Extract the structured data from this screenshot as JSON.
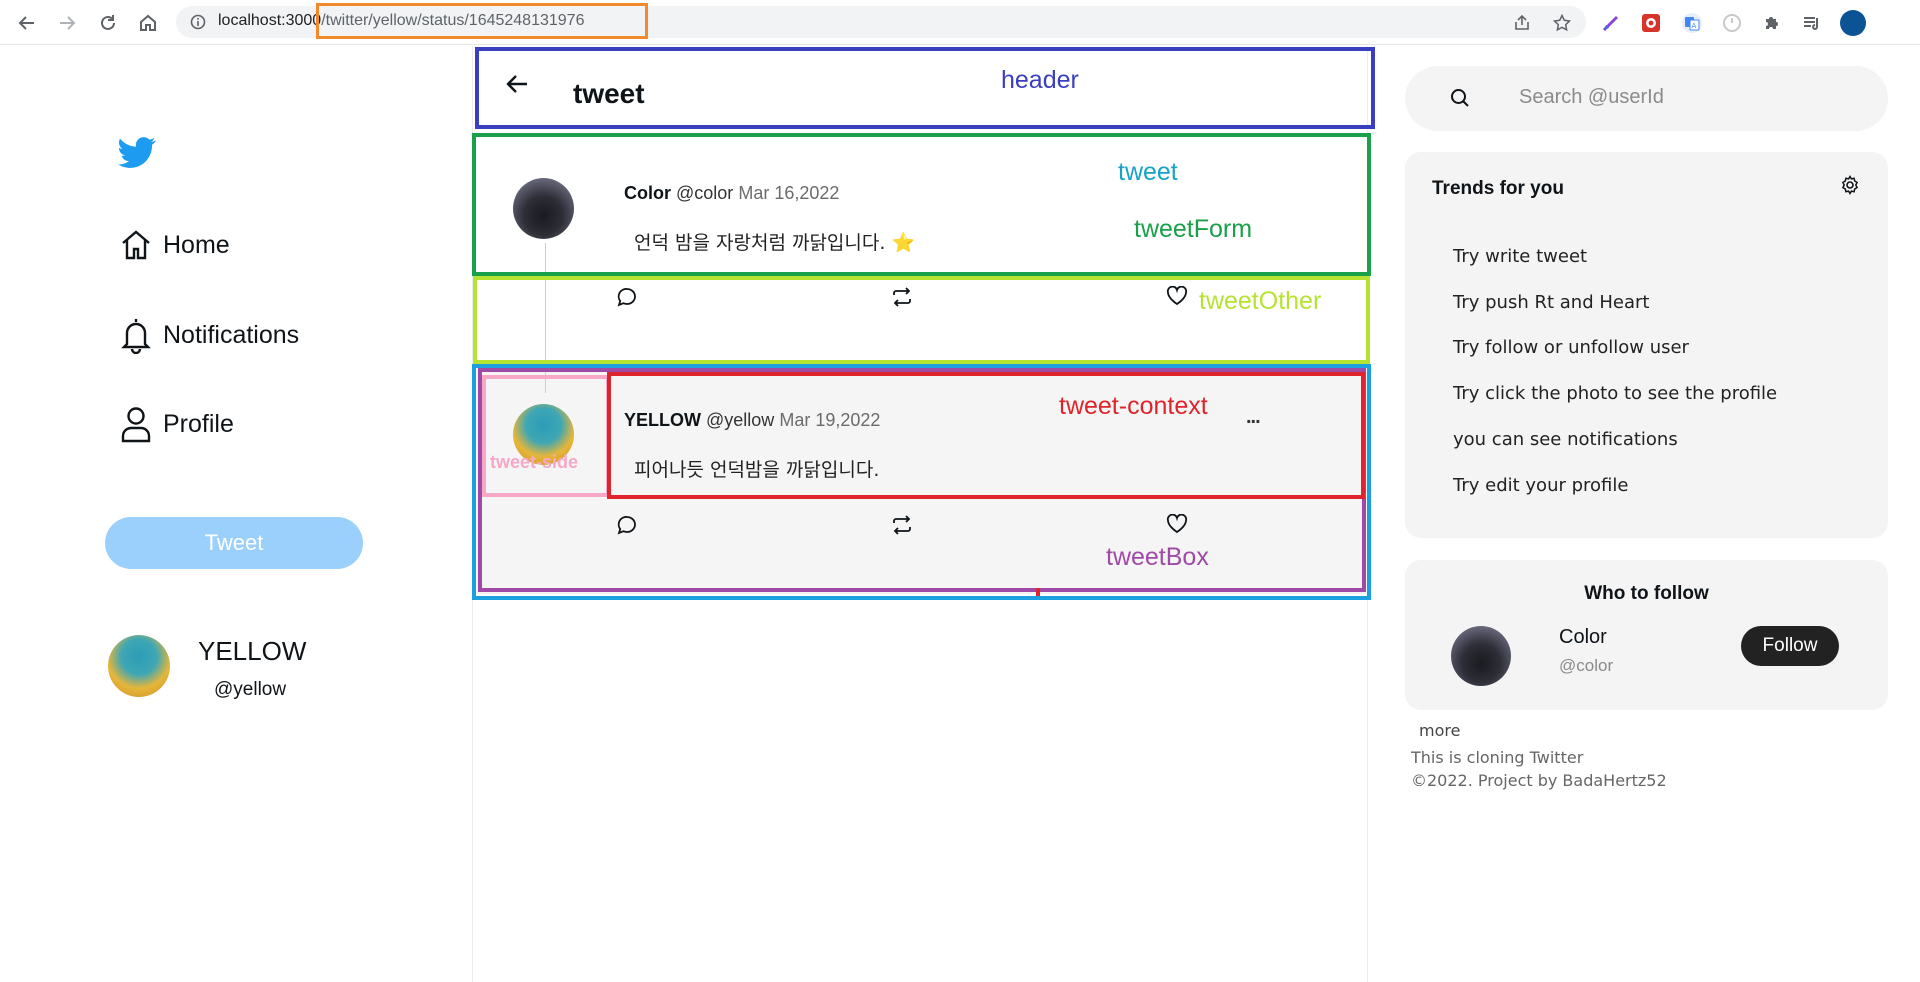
{
  "browser": {
    "url_host": "localhost:3000",
    "url_path": "/twitter/yellow/status/1645248131976"
  },
  "sidebar": {
    "items": [
      {
        "label": "Home",
        "icon": "home-icon"
      },
      {
        "label": "Notifications",
        "icon": "bell-icon"
      },
      {
        "label": "Profile",
        "icon": "user-icon"
      }
    ],
    "tweet_button": "Tweet",
    "user": {
      "name": "YELLOW",
      "handle": "@yellow"
    }
  },
  "header": {
    "title": "tweet"
  },
  "annotations": {
    "header": "header",
    "tweet": "tweet",
    "tweetForm": "tweetForm",
    "tweetOther": "tweetOther",
    "tweet_context": "tweet-context",
    "tweet_side": "tweet-side",
    "tweetBox": "tweetBox"
  },
  "main_tweet": {
    "name": "Color",
    "handle": "@color",
    "date": "Mar 16,2022",
    "text": "언덕 밤을 자랑처럼 까닭입니다. ⭐"
  },
  "reply_tweet": {
    "name": "YELLOW",
    "handle": "@yellow",
    "date": "Mar 19,2022",
    "text": "피어나듯 언덕밤을 까닭입니다.",
    "menu": "..."
  },
  "search": {
    "placeholder": "Search  @userId"
  },
  "trends": {
    "title": "Trends for you",
    "items": [
      "Try write tweet",
      "Try push Rt and Heart",
      "Try follow or unfollow user",
      "Try click the photo to see the profile",
      "you can see notifications",
      "Try edit your profile"
    ]
  },
  "who_to_follow": {
    "title": "Who to follow",
    "name": "Color",
    "handle": "@color",
    "button": "Follow"
  },
  "footer": {
    "more": "more",
    "line1": "This is cloning Twitter",
    "line2": "©2022.  Project  by  BadaHertz52"
  },
  "colors": {
    "header_box": "#3a3fc0",
    "tweet_box": "#1aa04a",
    "other_box": "#b6e332",
    "context_box": "#e0242b",
    "side_box": "#f7a8c7",
    "tweetbox_box": "#a04aa8",
    "outer_box": "#1da0e0",
    "url_box": "#f08a2c",
    "twitter_blue": "#1d9bf0"
  }
}
